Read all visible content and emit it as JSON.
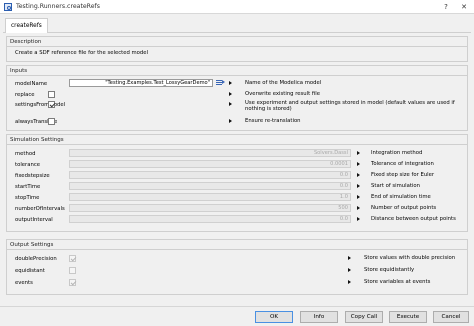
{
  "window": {
    "title": "Testing.Runners.createRefs"
  },
  "tab": {
    "label": "createRefs"
  },
  "description": {
    "header": "Description",
    "text": "Create a SDF reference file for the selected model"
  },
  "inputs": {
    "header": "Inputs",
    "rows": [
      {
        "label": "modelName",
        "value": "\"Testing.Examples.Test_LossyGearDemo\"",
        "desc": "Name of the Modelica model"
      },
      {
        "label": "replace",
        "checked": false,
        "desc": "Overwrite existing result file"
      },
      {
        "label": "settingsFromModel",
        "checked": true,
        "desc": "Use experiment and output settings stored in model (default values are used if nothing is stored)"
      },
      {
        "label": "alwaysTranslate",
        "checked": false,
        "desc": "Ensure re-translation"
      }
    ]
  },
  "simulation": {
    "header": "Simulation Settings",
    "rows": [
      {
        "label": "method",
        "value": "Solvers.Dassl",
        "desc": "Integration method"
      },
      {
        "label": "tolerance",
        "value": "0.0001",
        "desc": "Tolerance of integration"
      },
      {
        "label": "fixedstepsize",
        "value": "0.0",
        "desc": "Fixed step size for Euler"
      },
      {
        "label": "startTime",
        "value": "0.0",
        "desc": "Start of simulation"
      },
      {
        "label": "stopTime",
        "value": "1.0",
        "desc": "End of simulation time"
      },
      {
        "label": "numberOfIntervals",
        "value": "500",
        "desc": "Number of output points"
      },
      {
        "label": "outputInterval",
        "value": "0.0",
        "desc": "Distance between output points"
      }
    ]
  },
  "output": {
    "header": "Output Settings",
    "rows": [
      {
        "label": "doublePrecision",
        "checked": true,
        "desc": "Store values with double precision"
      },
      {
        "label": "equidistant",
        "checked": false,
        "desc": "Store equidistantly"
      },
      {
        "label": "events",
        "checked": true,
        "desc": "Store variables at events"
      }
    ]
  },
  "buttons": {
    "ok": "OK",
    "info": "Info",
    "copy_call": "Copy Call",
    "execute": "Execute",
    "cancel": "Cancel"
  }
}
